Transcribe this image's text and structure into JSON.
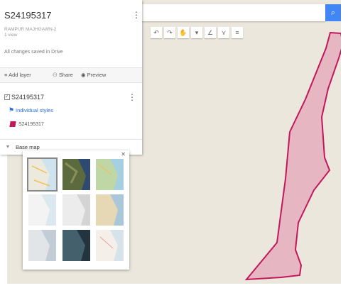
{
  "panel": {
    "title": "S24195317",
    "subtitle": "RAMPUR MAJHGAWN-2",
    "views": "1 view",
    "save_status": "All changes saved in Drive",
    "actions": {
      "add_layer": "Add layer",
      "share": "Share",
      "preview": "Preview"
    },
    "layer": {
      "name": "S24195317",
      "styles_link": "Individual styles",
      "item": "S24195317"
    },
    "basemap_label": "Base map"
  },
  "toolbar": {
    "icons": [
      "undo-icon",
      "redo-icon",
      "hand-icon",
      "marker-icon",
      "line-icon",
      "route-icon",
      "ruler-icon"
    ]
  },
  "search": {
    "placeholder": ""
  },
  "basemap_popup": {
    "thumbnails": [
      "Map",
      "Satellite",
      "Terrain",
      "Light political",
      "Mono city",
      "Simple atlas",
      "Light landmass",
      "Dark landmass",
      "Whitewater"
    ],
    "selected_index": 0
  },
  "colors": {
    "polygon_fill": "#e6b6c3",
    "polygon_stroke": "#c2185b",
    "map_bg": "#ebe7dc",
    "accent": "#4285f4"
  }
}
